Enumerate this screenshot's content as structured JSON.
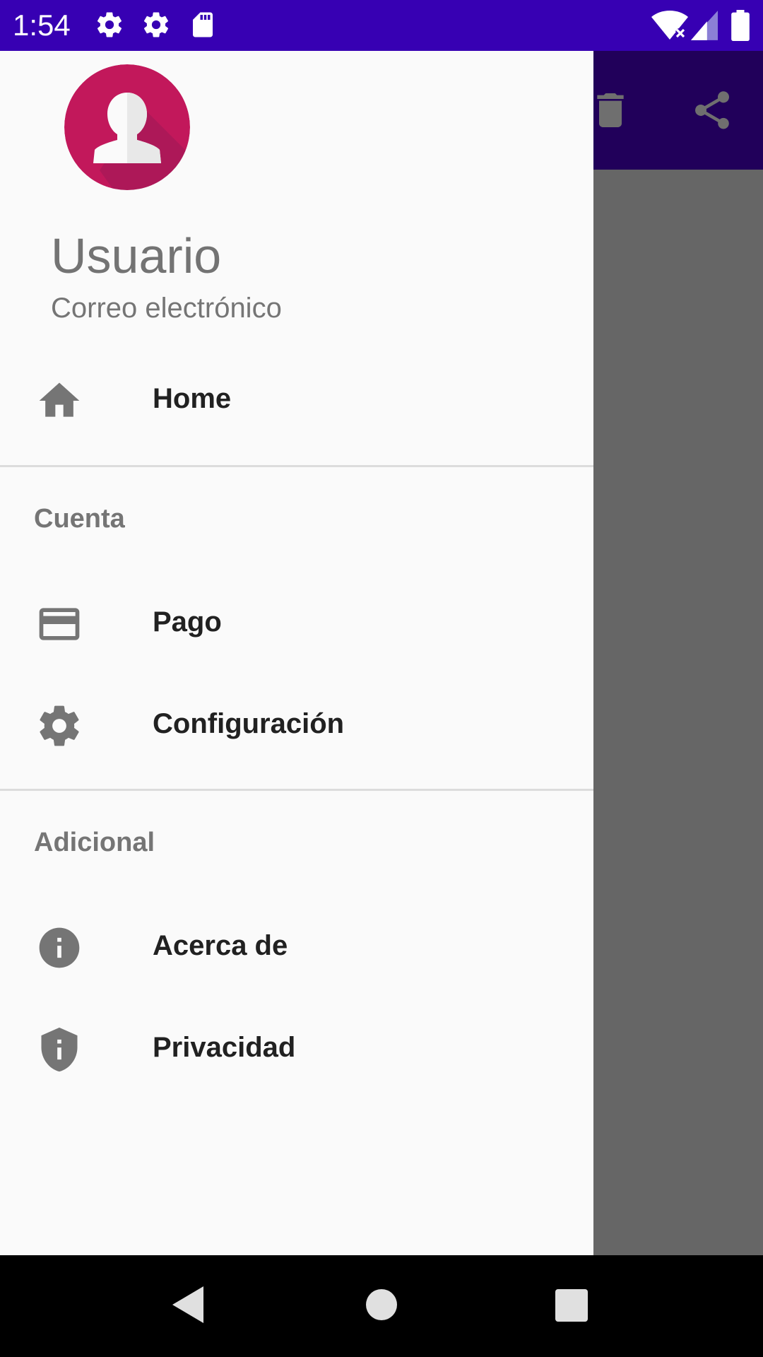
{
  "status_bar": {
    "time": "1:54",
    "left_icons": [
      "gear-icon",
      "gear-icon",
      "sd-card-icon"
    ],
    "right_icons": [
      "wifi-icon",
      "signal-icon",
      "battery-icon"
    ]
  },
  "app_bar": {
    "actions": [
      "delete-icon",
      "share-icon"
    ]
  },
  "drawer": {
    "header": {
      "avatar": "user-avatar",
      "name": "Usuario",
      "email": "Correo electrónico"
    },
    "items": [
      {
        "icon": "home-icon",
        "label": "Home"
      }
    ],
    "sections": [
      {
        "title": "Cuenta",
        "items": [
          {
            "icon": "credit-card-icon",
            "label": "Pago"
          },
          {
            "icon": "settings-icon",
            "label": "Configuración"
          }
        ]
      },
      {
        "title": "Adicional",
        "items": [
          {
            "icon": "info-icon",
            "label": "Acerca de"
          },
          {
            "icon": "shield-info-icon",
            "label": "Privacidad"
          }
        ]
      }
    ]
  },
  "nav_bar": {
    "buttons": [
      "back-icon",
      "home-circle-icon",
      "recents-icon"
    ]
  },
  "colors": {
    "status_bar": "#3700b3",
    "app_bar": "#21005a",
    "drawer_bg": "#fafafa",
    "scrim": "#666666",
    "avatar": "#c2185b"
  }
}
